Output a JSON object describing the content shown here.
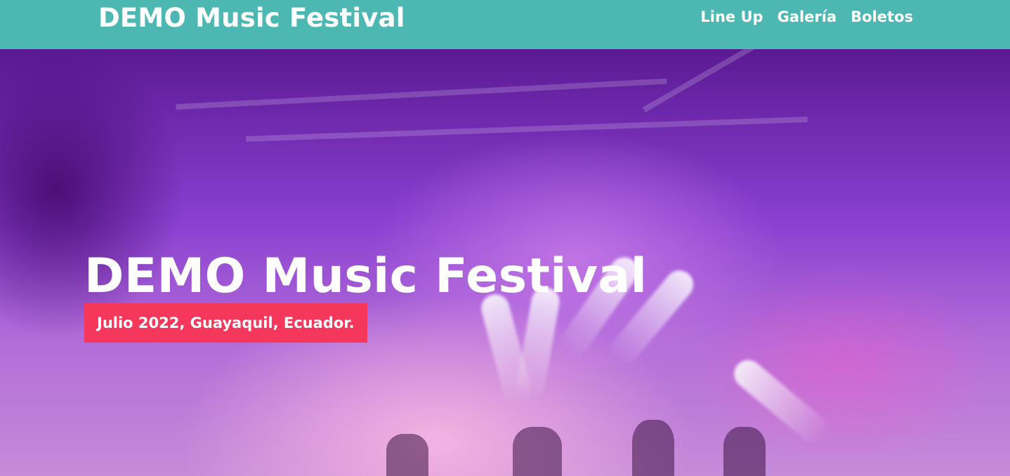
{
  "navbar": {
    "brand": "DEMO Music Festival",
    "links": [
      {
        "label": "Line Up"
      },
      {
        "label": "Galería"
      },
      {
        "label": "Boletos"
      }
    ]
  },
  "hero": {
    "title": "DEMO Music Festival",
    "date_location": "Julio 2022, Guayaquil, Ecuador.",
    "background_image": "concert-stage-photo"
  },
  "colors": {
    "navbar_bg": "#4db7b2",
    "badge_bg": "#f4375a",
    "text": "#ffffff"
  }
}
